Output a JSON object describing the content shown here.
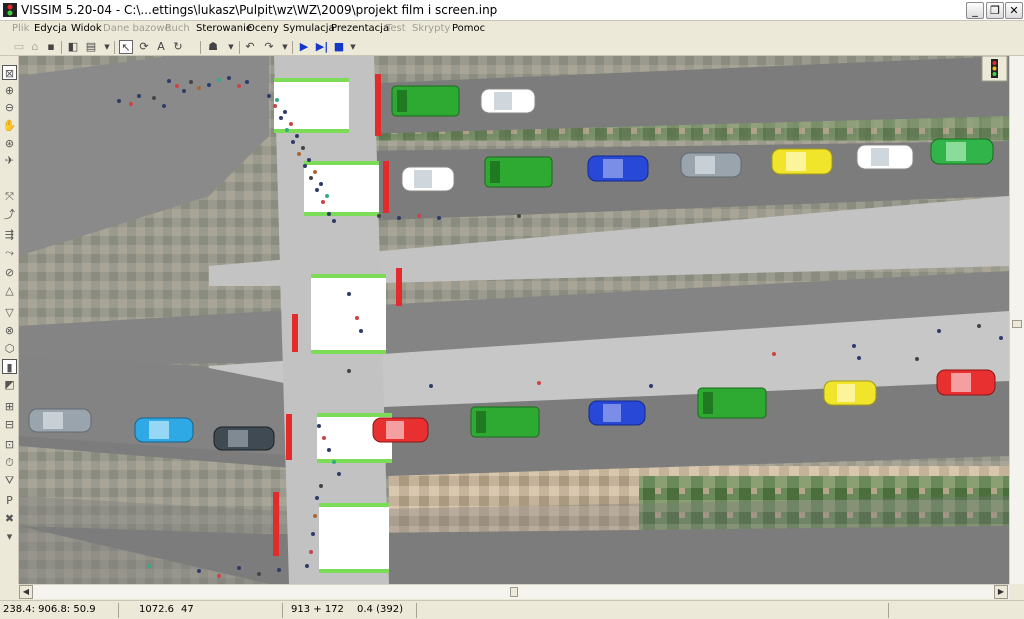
{
  "window": {
    "title": "VISSIM 5.20-04 - C:\\...ettings\\lukasz\\Pulpit\\wz\\WZ\\2009\\projekt film i screen.inp",
    "minimize_label": "_",
    "maximize_label": "❐",
    "close_label": "✕"
  },
  "menu": {
    "items": [
      {
        "label": "Plik",
        "enabled": false
      },
      {
        "label": "Edycja",
        "enabled": true
      },
      {
        "label": "Widok",
        "enabled": true
      },
      {
        "label": "Dane bazowe",
        "enabled": false
      },
      {
        "label": "Ruch",
        "enabled": false
      },
      {
        "label": "Sterowanie",
        "enabled": true
      },
      {
        "label": "Oceny",
        "enabled": true
      },
      {
        "label": "Symulacja",
        "enabled": true
      },
      {
        "label": "Prezentacja",
        "enabled": true
      },
      {
        "label": "Test",
        "enabled": false
      },
      {
        "label": "Skrypty",
        "enabled": false
      },
      {
        "label": "Pomoc",
        "enabled": true
      }
    ]
  },
  "toolbar": {
    "icons": [
      "new-file-icon",
      "open-file-icon",
      "save-icon",
      "print-preview-icon",
      "print-icon",
      "select-arrow-icon",
      "rotate-view-icon",
      "text-annotation-icon",
      "rotate-icon",
      "pedestrian-icon",
      "undo-icon",
      "redo-icon",
      "play-continuous-icon",
      "single-step-icon",
      "stop-icon"
    ]
  },
  "left_toolbar": {
    "icons": [
      "zoom-window-icon",
      "zoom-in-icon",
      "zoom-out-icon",
      "pan-hand-icon",
      "rotate-3d-icon",
      "fly-icon",
      "links-icon",
      "connectors-icon",
      "vehicle-inputs-icon",
      "routing-icon",
      "speed-decisions-icon",
      "reduced-speed-icon",
      "priority-rules-icon",
      "signal-heads-icon",
      "stop-signs-icon",
      "detectors-icon",
      "pt-stops-icon",
      "pt-lines-icon",
      "parking-icon",
      "nodes-icon",
      "travel-time-icon",
      "queue-counters-icon",
      "data-collection-icon",
      "parking-lots-icon",
      "delete-icon"
    ]
  },
  "status": {
    "coordinates": "238.4: 906.8: 50.9",
    "link_number": "1072.6",
    "link_segment": "47",
    "position": "913 + 172",
    "sim_time": "0.4 (392)"
  },
  "colors": {
    "road": "#8a8a8a",
    "sidewalk": "#c5c5c5",
    "crosswalk": "#ffffff",
    "crosswalk_edge": "#7ddc57",
    "stop_line": "#e32b2b",
    "window_bg": "#ece9d8"
  },
  "vehicles": [
    {
      "type": "van",
      "color": "#2eaa32",
      "lane": "eastbound-top"
    },
    {
      "type": "car",
      "color": "#ffffff",
      "lane": "eastbound-top"
    },
    {
      "type": "car",
      "color": "#ffffff",
      "lane": "eastbound-mid"
    },
    {
      "type": "van",
      "color": "#2eaa32",
      "lane": "eastbound-mid"
    },
    {
      "type": "car",
      "color": "#2848d8",
      "lane": "eastbound-mid"
    },
    {
      "type": "car",
      "color": "#9aa4ad",
      "lane": "eastbound-mid"
    },
    {
      "type": "car",
      "color": "#f0e52a",
      "lane": "eastbound-mid"
    },
    {
      "type": "car",
      "color": "#ffffff",
      "lane": "eastbound-mid"
    },
    {
      "type": "car",
      "color": "#31b54a",
      "lane": "eastbound-mid"
    },
    {
      "type": "car",
      "color": "#9aa4ad",
      "lane": "westbound-left"
    },
    {
      "type": "car",
      "color": "#2fa9e6",
      "lane": "westbound-left"
    },
    {
      "type": "car",
      "color": "#404a52",
      "lane": "westbound-left"
    },
    {
      "type": "car",
      "color": "#e83030",
      "lane": "westbound-right"
    },
    {
      "type": "van",
      "color": "#2eaa32",
      "lane": "westbound-right"
    },
    {
      "type": "car",
      "color": "#2848d8",
      "lane": "westbound-right"
    },
    {
      "type": "van",
      "color": "#2eaa32",
      "lane": "westbound-right"
    },
    {
      "type": "car",
      "color": "#f0e52a",
      "lane": "westbound-right"
    },
    {
      "type": "car",
      "color": "#e83030",
      "lane": "westbound-right"
    }
  ]
}
